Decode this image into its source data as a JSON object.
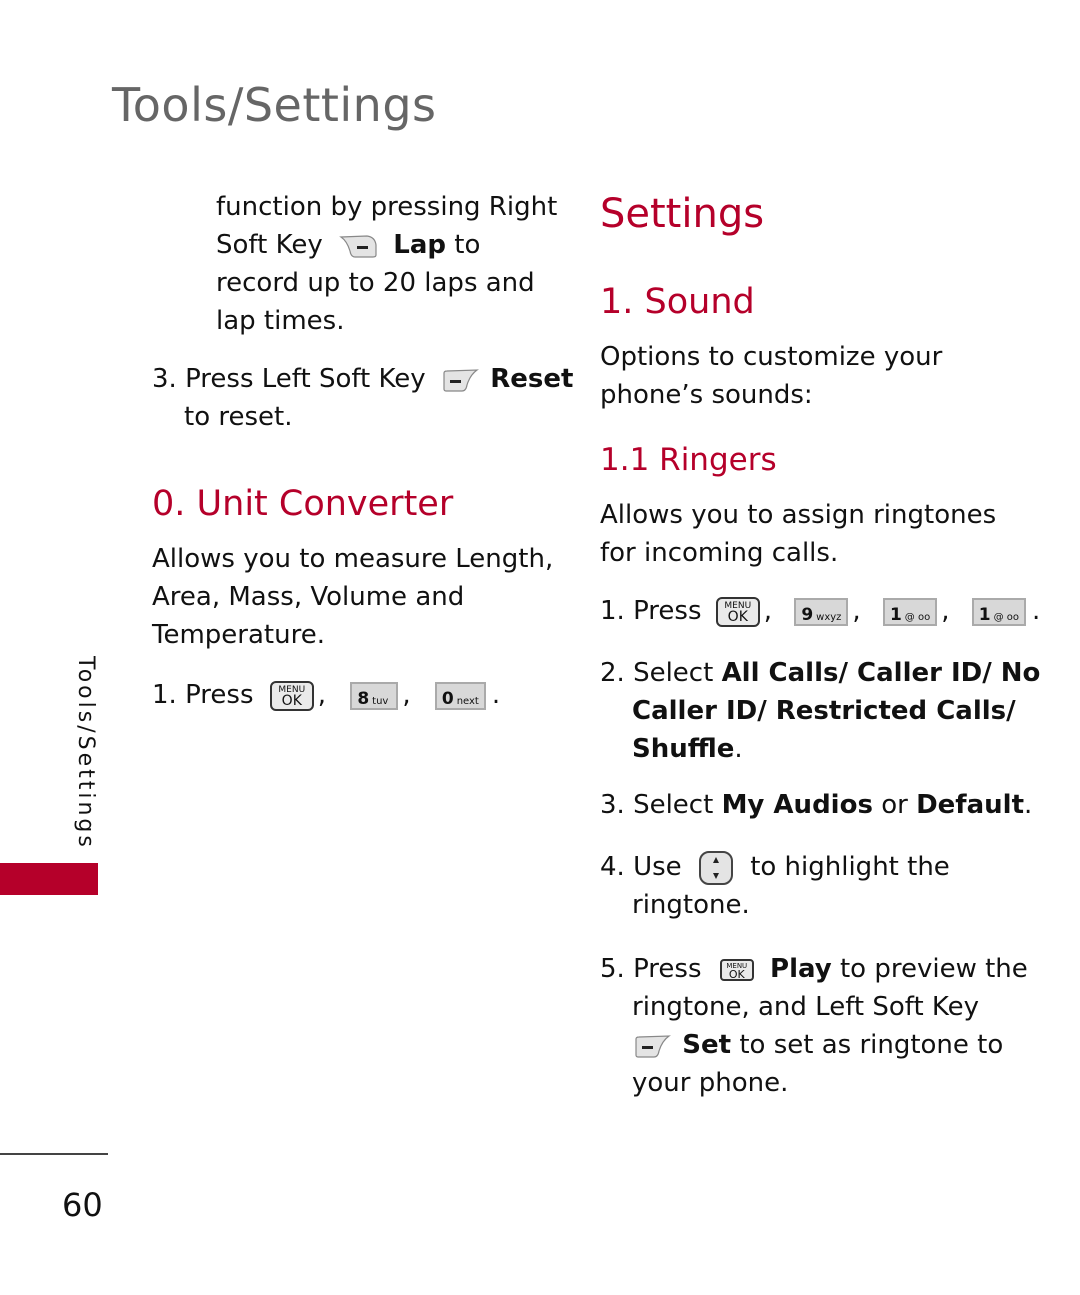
{
  "running_head": "Tools/Settings",
  "side_tab_label": "Tools/Settings",
  "page_number": "60",
  "colors": {
    "accent": "#b5002a",
    "running_head": "#666666",
    "text": "#111111"
  },
  "left_column": {
    "continued_paragraph": {
      "line1": "function by pressing Right",
      "line2_pre": "Soft Key",
      "line2_key_icon": "right-soft-key-icon",
      "line2_bold": "Lap",
      "line2_post": "to",
      "line3": "record up to 20 laps and",
      "line4": "lap times."
    },
    "step3": {
      "number": "3.",
      "pre": "Press Left Soft Key",
      "key_icon": "left-soft-key-icon",
      "bold": "Reset",
      "line2": "to reset."
    },
    "unit_converter": {
      "heading": "0. Unit Converter",
      "desc_lines": [
        "Allows you to measure Length,",
        "Area, Mass, Volume and",
        "Temperature."
      ],
      "step1": {
        "number": "1.",
        "label": "Press",
        "keys": [
          {
            "type": "menu",
            "top": "MENU",
            "bottom": "OK"
          },
          {
            "type": "num",
            "digit": "8",
            "letters": "tuv"
          },
          {
            "type": "num",
            "digit": "0",
            "letters": "next"
          }
        ],
        "separator": ",",
        "end": "."
      }
    }
  },
  "right_column": {
    "section_title": "Settings",
    "sound": {
      "heading": "1. Sound",
      "desc_lines": [
        "Options to customize your",
        "phone’s sounds:"
      ]
    },
    "ringers": {
      "heading": "1.1 Ringers",
      "desc_lines": [
        "Allows you to assign ringtones",
        "for incoming calls."
      ],
      "step1": {
        "number": "1.",
        "label": "Press",
        "keys": [
          {
            "type": "menu",
            "top": "MENU",
            "bottom": "OK"
          },
          {
            "type": "num",
            "digit": "9",
            "letters": "wxyz"
          },
          {
            "type": "num",
            "digit": "1",
            "letters": "@ oo"
          },
          {
            "type": "num",
            "digit": "1",
            "letters": "@ oo"
          }
        ],
        "separator": ",",
        "end": "."
      },
      "step2": {
        "number": "2.",
        "pre": "Select",
        "bold_line1": "All Calls/ Caller ID/ No",
        "bold_line2": "Caller ID/ Restricted Calls/",
        "bold_line3": "Shuffle",
        "end": "."
      },
      "step3": {
        "number": "3.",
        "pre": "Select",
        "bold1": "My Audios",
        "mid": "or",
        "bold2": "Default",
        "end": "."
      },
      "step4": {
        "number": "4.",
        "pre": "Use",
        "key_icon": "up-down-navigation-key-icon",
        "post": "to highlight the",
        "line2": "ringtone."
      },
      "step5": {
        "number": "5.",
        "pre": "Press",
        "key": {
          "top": "MENU",
          "bottom": "OK"
        },
        "bold1": "Play",
        "post1": "to preview the",
        "line2": "ringtone, and Left Soft Key",
        "bold2": "Set",
        "post2": "to set as ringtone to",
        "line4": "your phone."
      }
    }
  }
}
